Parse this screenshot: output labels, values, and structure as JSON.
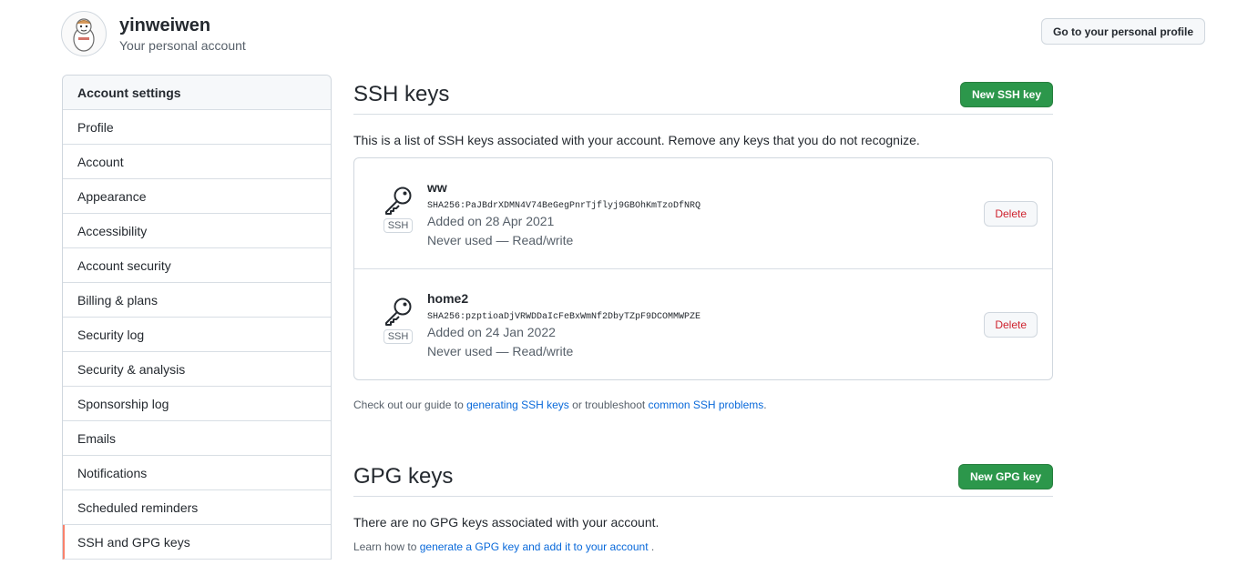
{
  "header": {
    "username": "yinweiwen",
    "subtitle": "Your personal account",
    "profile_button": "Go to your personal profile"
  },
  "sidebar": {
    "heading": "Account settings",
    "items": [
      {
        "label": "Profile"
      },
      {
        "label": "Account"
      },
      {
        "label": "Appearance"
      },
      {
        "label": "Accessibility"
      },
      {
        "label": "Account security"
      },
      {
        "label": "Billing & plans"
      },
      {
        "label": "Security log"
      },
      {
        "label": "Security & analysis"
      },
      {
        "label": "Sponsorship log"
      },
      {
        "label": "Emails"
      },
      {
        "label": "Notifications"
      },
      {
        "label": "Scheduled reminders"
      },
      {
        "label": "SSH and GPG keys"
      }
    ],
    "selected_index": 12,
    "selected_accent": "#f9826c"
  },
  "ssh": {
    "title": "SSH keys",
    "new_button": "New SSH key",
    "description": "This is a list of SSH keys associated with your account. Remove any keys that you do not recognize.",
    "keys": [
      {
        "title": "ww",
        "fingerprint": "SHA256:PaJBdrXDMN4V74BeGegPnrTjflyj9GBOhKmTzoDfNRQ",
        "added": "Added on 28 Apr 2021",
        "usage": "Never used — Read/write",
        "badge": "SSH",
        "delete_label": "Delete"
      },
      {
        "title": "home2",
        "fingerprint": "SHA256:pzptioaDjVRWDDaIcFeBxWmNf2DbyTZpF9DCOMMWPZE",
        "added": "Added on 24 Jan 2022",
        "usage": "Never used — Read/write",
        "badge": "SSH",
        "delete_label": "Delete"
      }
    ],
    "note_prefix": "Check out our guide to ",
    "note_link1": "generating SSH keys",
    "note_middle": " or troubleshoot ",
    "note_link2": "common SSH problems",
    "note_suffix": "."
  },
  "gpg": {
    "title": "GPG keys",
    "new_button": "New GPG key",
    "description": "There are no GPG keys associated with your account.",
    "note_prefix": "Learn how to ",
    "note_link": "generate a GPG key and add it to your account",
    "note_suffix": " ."
  },
  "colors": {
    "primary_green": "#2c974b",
    "link_blue": "#0969da",
    "danger_red": "#cf222e"
  }
}
